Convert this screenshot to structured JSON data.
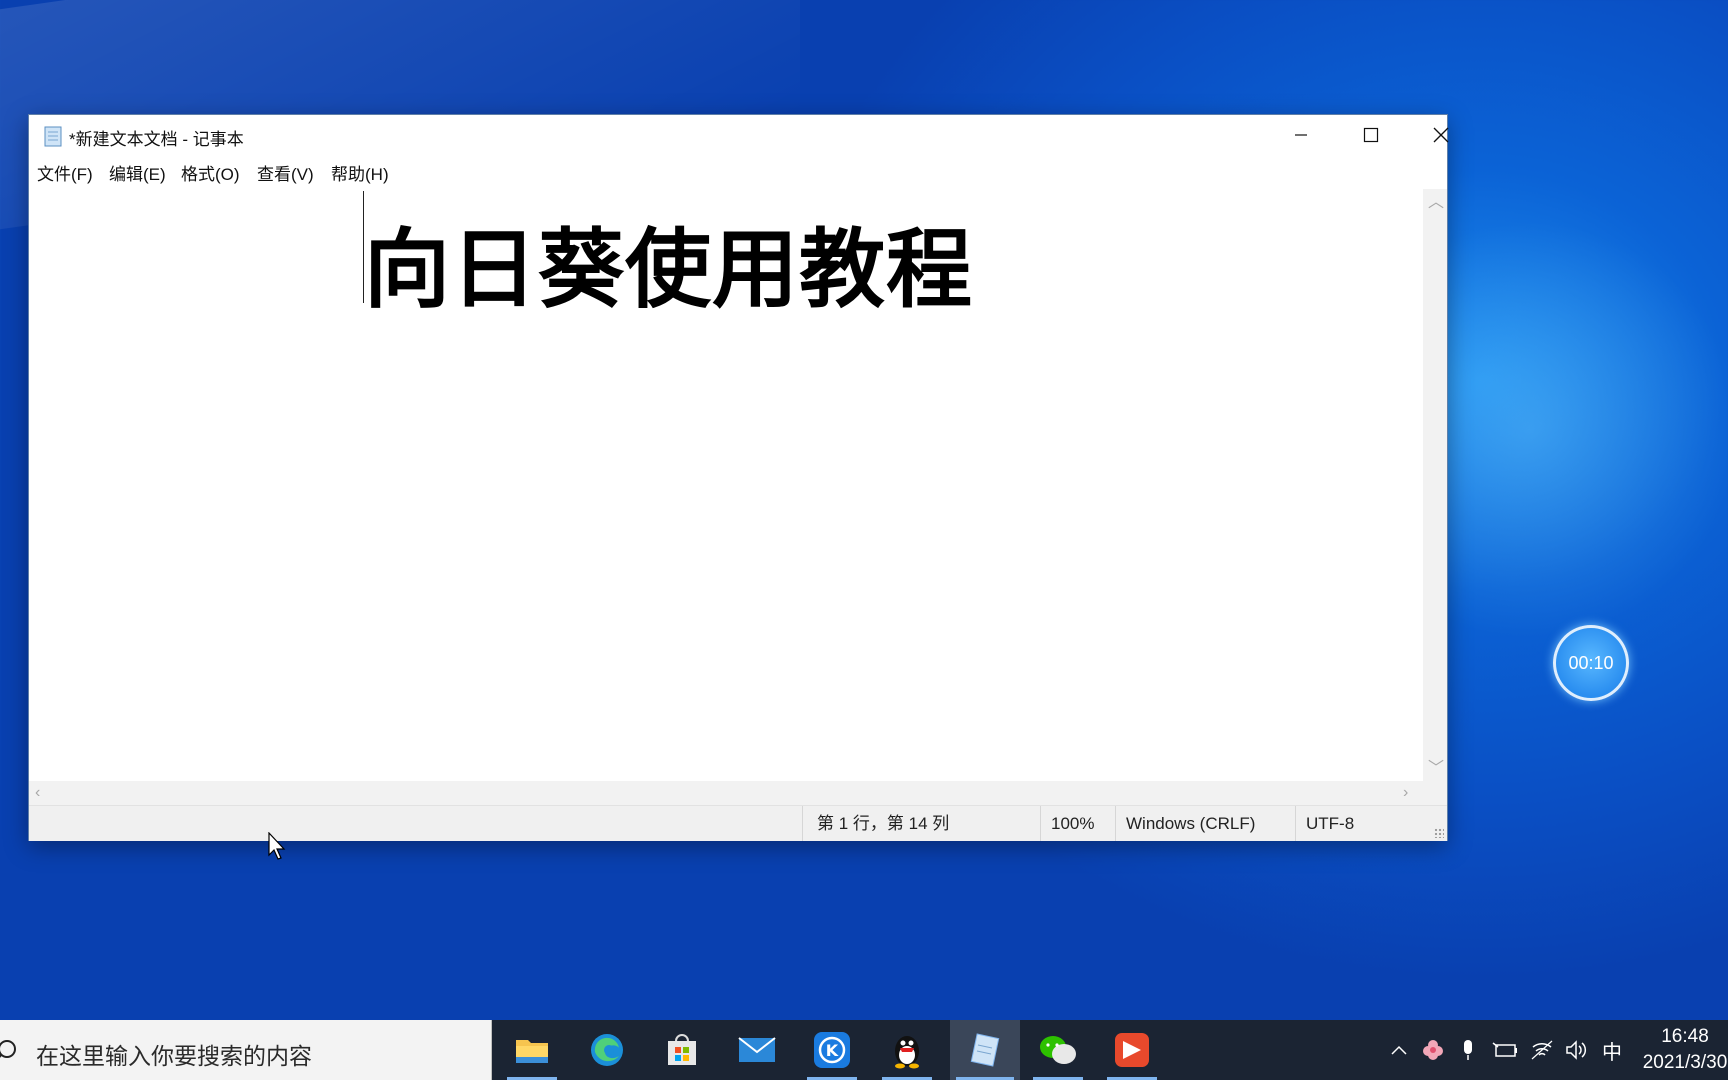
{
  "window": {
    "title": "*新建文本文档 - 记事本",
    "menu": [
      "文件(F)",
      "编辑(E)",
      "格式(O)",
      "查看(V)",
      "帮助(H)"
    ]
  },
  "editor": {
    "content": "向日葵使用教程"
  },
  "status": {
    "position": "第 1 行，第 14 列",
    "zoom": "100%",
    "line_ending": "Windows (CRLF)",
    "encoding": "UTF-8"
  },
  "timer": {
    "elapsed": "00:10"
  },
  "taskbar": {
    "search_placeholder": "在这里输入你要搜索的内容",
    "apps": [
      "file-explorer",
      "edge",
      "store",
      "mail",
      "kugou",
      "qq",
      "notepad",
      "wechat",
      "presentation"
    ],
    "ime": "中",
    "time": "16:48",
    "date": "2021/3/30"
  },
  "colors": {
    "desktop": "#0b63d6",
    "taskbar": "#1b2433",
    "accent": "#7fb4ee"
  }
}
